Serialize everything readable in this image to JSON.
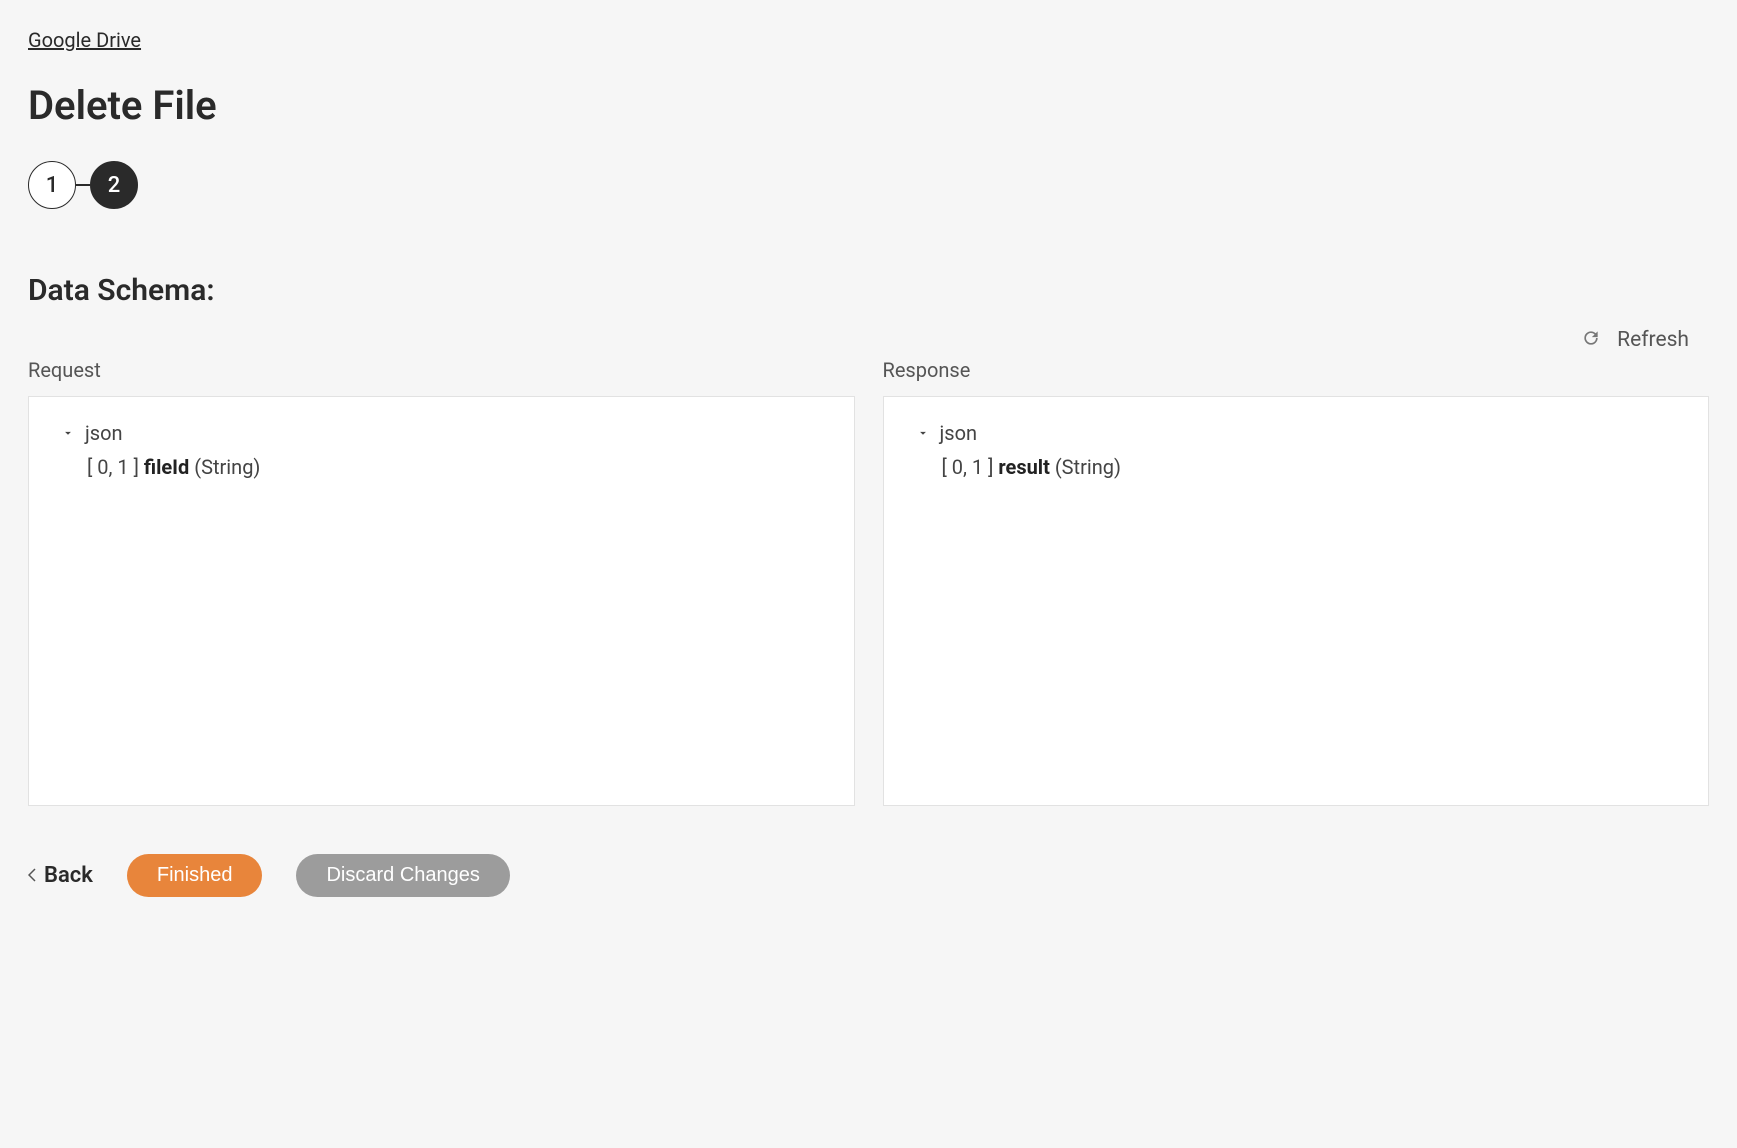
{
  "breadcrumb": "Google Drive",
  "page_title": "Delete File",
  "stepper": {
    "step1": "1",
    "step2": "2"
  },
  "section_title": "Data Schema:",
  "refresh_label": "Refresh",
  "request": {
    "label": "Request",
    "root": "json",
    "field_cardinality": "[ 0, 1 ]",
    "field_name": "fileId",
    "field_type": "(String)"
  },
  "response": {
    "label": "Response",
    "root": "json",
    "field_cardinality": "[ 0, 1 ]",
    "field_name": "result",
    "field_type": "(String)"
  },
  "buttons": {
    "back": "Back",
    "finished": "Finished",
    "discard": "Discard Changes"
  }
}
